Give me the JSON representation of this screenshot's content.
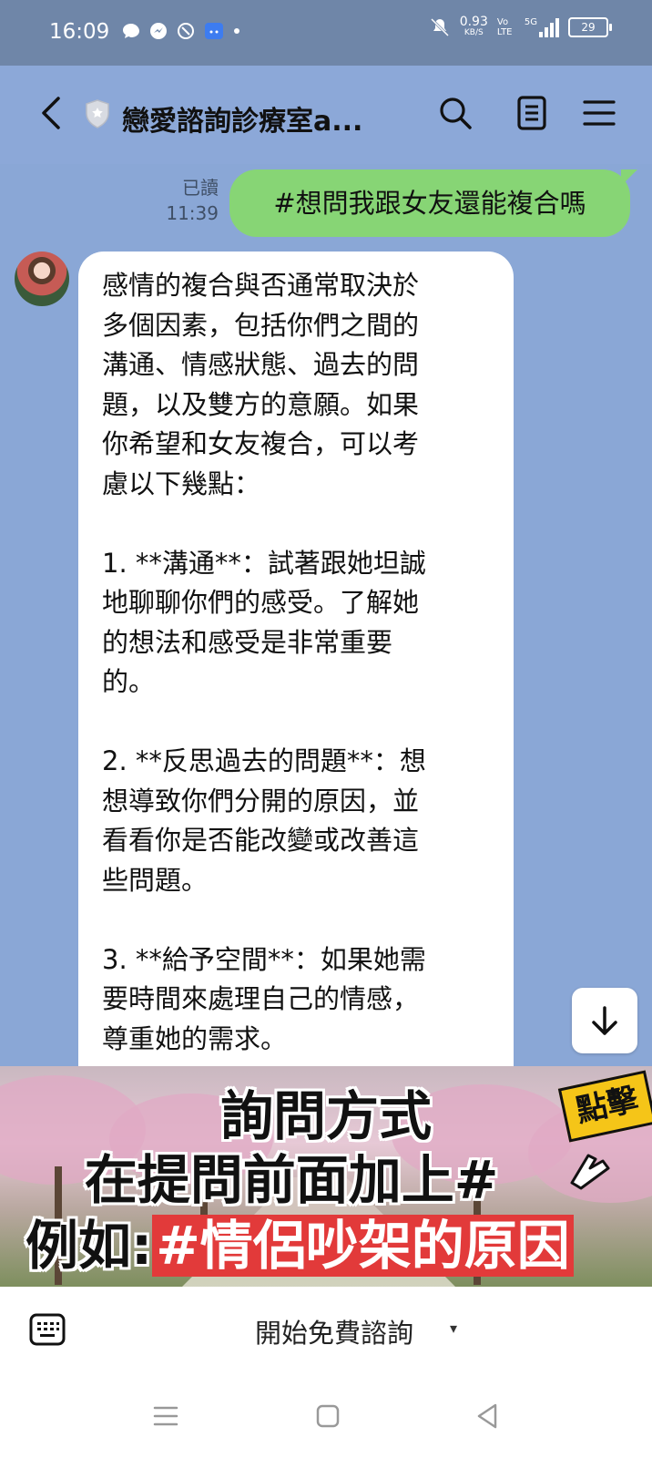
{
  "status_bar": {
    "time": "16:09",
    "net_speed": "0.93",
    "net_unit": "KB/S",
    "volte": "Vo LTE",
    "signal": "5G",
    "battery": "29",
    "icons": [
      "chat-bubble-icon",
      "messenger-icon",
      "app-icon",
      "android-icon",
      "dot-icon",
      "mute-icon",
      "signal-icon",
      "battery-icon"
    ]
  },
  "header": {
    "title": "戀愛諮詢診療室a..."
  },
  "messages": {
    "outgoing": {
      "read_label": "已讀",
      "time": "11:39",
      "text": "#想問我跟女友還能複合嗎"
    },
    "incoming": {
      "text": "感情的複合與否通常取決於\n多個因素，包括你們之間的\n溝通、情感狀態、過去的問\n題，以及雙方的意願。如果\n你希望和女友複合，可以考\n慮以下幾點：\n\n1. **溝通**：試著跟她坦誠\n地聊聊你們的感受。了解她\n的想法和感受是非常重要\n的。\n\n2. **反思過去的問題**：想\n想導致你們分開的原因，並\n看看你是否能改變或改善這\n些問題。\n\n3. **給予空間**：如果她需\n要時間來處理自己的情感，\n尊重她的需求。"
    }
  },
  "banner": {
    "line1": "詢問方式",
    "line2": "在提問前面加上#",
    "line3_prefix": "例如:",
    "line3_highlight": "#情侶吵架的原因",
    "badge": "點擊"
  },
  "input_bar": {
    "menu_label": "開始免費諮詢",
    "caret": "▾"
  },
  "colors": {
    "chat_bg": "#8aa7d6",
    "outgoing_bubble": "#87d575",
    "highlight_red": "#e23a3a",
    "badge_yellow": "#f5c518"
  }
}
